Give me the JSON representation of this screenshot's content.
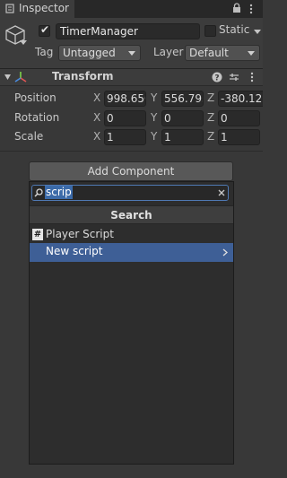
{
  "tab": {
    "label": "Inspector"
  },
  "header": {
    "name": "TimerManager",
    "active_check": "✔",
    "static_label": "Static",
    "tag_label": "Tag",
    "tag_value": "Untagged",
    "layer_label": "Layer",
    "layer_value": "Default"
  },
  "transform": {
    "title": "Transform",
    "rows": [
      {
        "label": "Position",
        "x": "998.650",
        "y": "556.793",
        "z": "-380.12"
      },
      {
        "label": "Rotation",
        "x": "0",
        "y": "0",
        "z": "0"
      },
      {
        "label": "Scale",
        "x": "1",
        "y": "1",
        "z": "1"
      }
    ],
    "axes": {
      "x": "X",
      "y": "Y",
      "z": "Z"
    }
  },
  "add_component": {
    "button_label": "Add Component",
    "search_value": "scrip",
    "results_header": "Search",
    "items": [
      {
        "label": "Player Script",
        "icon": "#"
      },
      {
        "label": "New script"
      }
    ]
  },
  "colors": {
    "panel": "#383838",
    "header": "#3c3c3c",
    "selection": "#3e5f96",
    "search_focus": "#4f79b3"
  }
}
